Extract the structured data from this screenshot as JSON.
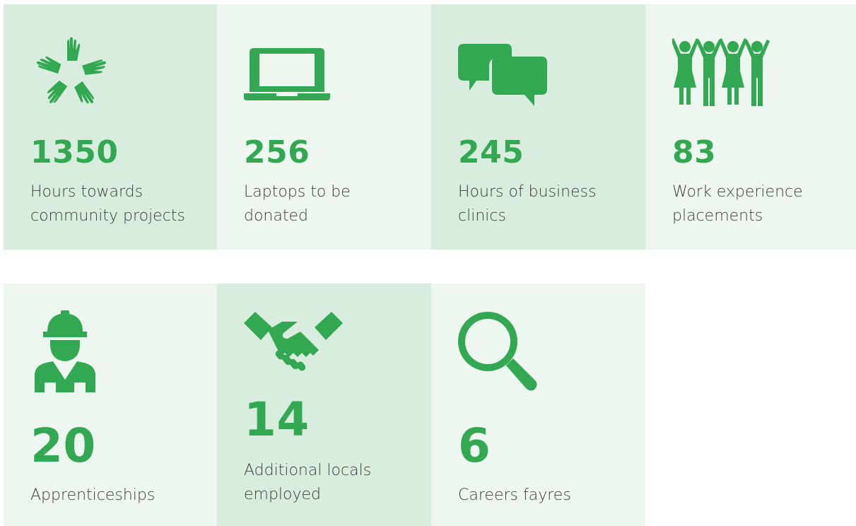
{
  "colors": {
    "accent": "#33a852",
    "tile_dark": "#d8eddd",
    "tile_light": "#eef7ef",
    "text": "#3d3d3d"
  },
  "stats": [
    {
      "icon": "hands-circle-icon",
      "value": "1350",
      "label": "Hours towards community projects"
    },
    {
      "icon": "laptop-icon",
      "value": "256",
      "label": "Laptops to be donated"
    },
    {
      "icon": "speech-bubbles-icon",
      "value": "245",
      "label": "Hours of business clinics"
    },
    {
      "icon": "group-of-people-icon",
      "value": "83",
      "label": "Work experience placements"
    },
    {
      "icon": "construction-worker-icon",
      "value": "20",
      "label": "Apprenticeships"
    },
    {
      "icon": "handshake-icon",
      "value": "14",
      "label": "Additional locals employed"
    },
    {
      "icon": "magnifying-glass-icon",
      "value": "6",
      "label": "Careers fayres"
    }
  ]
}
